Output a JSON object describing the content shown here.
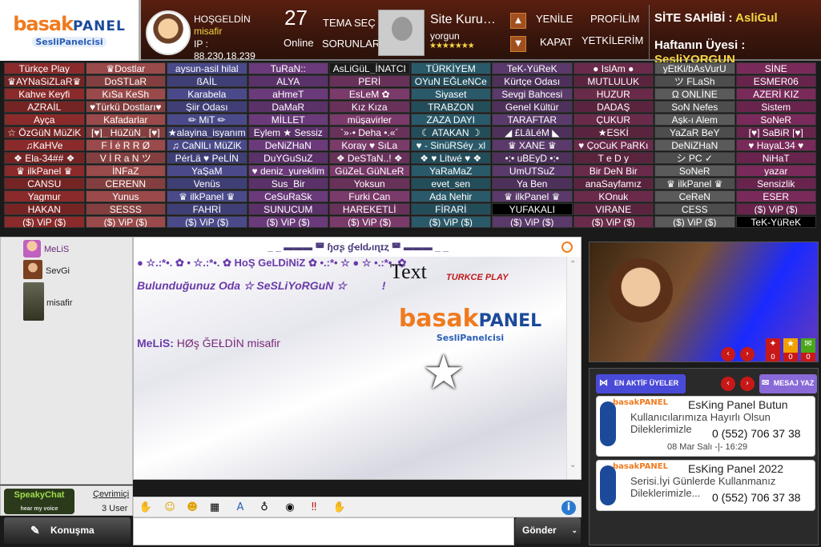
{
  "header": {
    "welcome": "HOŞGELDİN",
    "username": "misafir",
    "ip_label": "IP :",
    "ip": "88.230.18.239",
    "online_count": "27",
    "online_label": "Online",
    "theme_btn": "TEMA SEÇ",
    "issues_btn": "SORUNLAR",
    "founder_title": "Site Kuru…",
    "founder_name": "yorgun",
    "founder_stars": "★★★★★★★",
    "new_btn": "YENİLE",
    "close_btn": "KAPAT",
    "profile_btn": "PROFİLİM",
    "auth_btn": "YETKİLERİM",
    "owner_label": "SİTE SAHİBİ :",
    "owner_name": "AsliGul",
    "member_label": "Haftanın Üyesi :",
    "member_name": "SesliYORGUN"
  },
  "logo": {
    "brand1": "basak",
    "brand2": "PANEL",
    "sub": "SesliPanelcisi"
  },
  "rooms": [
    [
      "Türkçe Play",
      "♛Dostlar",
      "aysun-asil hilal",
      "TuRaN::",
      "AsLiGüL_İNATCI",
      "TÜRKİYEM",
      "TeK-YüReK",
      "● IslAm ●",
      "yEtKi/bAsVurU",
      "SİNE"
    ],
    [
      "♛AYNaSiZLaR♛",
      "DoSTLaR",
      "ßAİL",
      "ALYA",
      "PERİ",
      "OYuN EĞLeNCe",
      "Kürtçe Odası",
      "MUTLULUK",
      "ツ FLaSh",
      "ESMER06"
    ],
    [
      "Kahve Keyfi",
      "KıSa KeSh",
      "Karabela",
      "aHmeT",
      "EsLeM ✿",
      "Siyaset",
      "Sevgi Bahcesi",
      "HUZUR",
      "Ω ONLİNE",
      "AZERİ KIZ"
    ],
    [
      "AZRAİL",
      "♥Türkü Dostları♥",
      "Şiir Odası",
      "DaMaR",
      "Kız Kıza",
      "TRABZON",
      "Genel Kültür",
      "DADAŞ",
      "SoN Nefes",
      "Sistem"
    ],
    [
      "Ayça",
      "Kafadarlar",
      "✏ MiT ✏",
      "MİLLET",
      "müşavirler",
      "ZAZA DAYI",
      "TARAFTAR",
      "ÇUKUR",
      "Aşk-ı Alem",
      "SoNeR"
    ],
    [
      "☆ ÖzGüN MüZiK",
      "[♥]_ HüZüN_ [♥]",
      "★alayina_isyanım",
      "Eylem ★ Sessiz",
      "`»·• Deha •.«´",
      "☾ ATAKAN ☽",
      "◢ £LâLéM ◣",
      "★ESKİ",
      "YaZaR BeY",
      "[♥] SaBiR [♥]"
    ],
    [
      "♫KaHVe",
      "F İ é R R Ø",
      "♫ CaNlLı MüZiK",
      "DeNiZHaN",
      "Koray ♥ SıLa",
      "♥ - SinüRSéy_xl",
      "♛ XANE ♛",
      "♥ ÇoCuK PaRKı",
      "DeNiZHaN",
      "♥ HayaL34 ♥"
    ],
    [
      "❖ Ela-34## ❖",
      "V İ R a N ツ",
      "PérLä ♥ PeLİN",
      "DuYGuSuZ",
      "❖ DeSTaN..! ❖",
      "❖ ♥ Litwé ♥ ❖",
      "•:• uBEyD •:•",
      "T e D y",
      "シ PC ✓",
      "NiHaT"
    ],
    [
      "♛ ilkPanel ♛",
      "İNFaZ",
      "YaŞaM",
      "♥ deniz_yureklim",
      "GüZeL GüNLeR",
      "YaRaMaZ",
      "UmUTSuZ",
      "Bir DeN Bir",
      "SoNeR",
      "yazar"
    ],
    [
      "CANSU",
      "CERENN",
      "Venüs",
      "Sus_Bir",
      "Yoksun",
      "evet_sen",
      "Ya Ben",
      "anaSayfamız",
      "♛ ilkPanel ♛",
      "Sensizlik"
    ],
    [
      "Yagmur",
      "Yunus",
      "♛ ilkPanel ♛",
      "CeSuRaSk",
      "Furki Can",
      "Ada Nehir",
      "♛ ilkPanel ♛",
      "KOnuk",
      "CeReN",
      "ESER"
    ],
    [
      "HAKAN",
      "SESSS",
      "FAHRİ",
      "SUNUCUM",
      "HAREKETLİ",
      "FİRARİ",
      "YUFAKALI",
      "VIRANE",
      "CESS",
      "($) ViP ($)"
    ],
    [
      "($) ViP ($)",
      "($) ViP ($)",
      "($) ViP ($)",
      "($) ViP ($)",
      "($) ViP ($)",
      "($) ViP ($)",
      "($) ViP ($)",
      "($) ViP ($)",
      "($) ViP ($)",
      "TeK-YüReK"
    ]
  ],
  "room_colors": [
    "#8a2a2a",
    "#9a4a4a",
    "#4a4a8a",
    "#6a3a7a",
    "#7a3a6a",
    "#2a5a6a",
    "#5a3a6a",
    "#6a2a4a",
    "#5a5a5a",
    "#7a2a5a"
  ],
  "users": [
    {
      "name": "MeLiS"
    },
    {
      "name": "SevGi"
    },
    {
      "name": "misafir"
    }
  ],
  "left_footer": {
    "speaky": "SpeakyChat",
    "tagline": "hear my voice",
    "link": "Çevrimiçi",
    "count": "3 User"
  },
  "chat": {
    "title": "_ _ ▬▬▬ ◚ ɧσʂ ɠҽӀԃιɳɪȥ ◚ ▬▬▬ _ _",
    "greeting": "● ☆.:*•. ✿ • ☆.:*•. ✿ HoŞ GeLDiNiZ ✿ •.:*• ☆ ● ☆ •.:*•. ✿",
    "room_line": "Bulunduğunuz Oda ☆ SeSLiYoRGuN ☆",
    "room_suffix": "!",
    "text_overlay": "Text",
    "play_badge": "TURKCE PLAY",
    "msg_user": "MeLiS:",
    "msg_text": "HØş ĞEŁDİN misafir"
  },
  "buttons": {
    "speak": "Konuşma",
    "send": "Gönder"
  },
  "right": {
    "active_btn": "EN AKTİF ÜYELER",
    "message_btn": "MESAJ YAZ",
    "counters": [
      "0",
      "0",
      "0"
    ],
    "news": [
      {
        "brand": "basakPANEL",
        "title": "EsKing Panel Butun",
        "body": "Kullanıcılarımıza Hayırlı Olsun Dileklerimizle",
        "phone": "0 (552) 706 37 38",
        "date": "08 Mar Salı -|- 16:29"
      },
      {
        "brand": "basakPANEL",
        "title": "EsKing Panel 2022",
        "body": "Serisi.İyi Günlerde Kullanmanız Dileklerimizle...",
        "phone": "0 (552) 706 37 38",
        "date": ""
      }
    ]
  }
}
